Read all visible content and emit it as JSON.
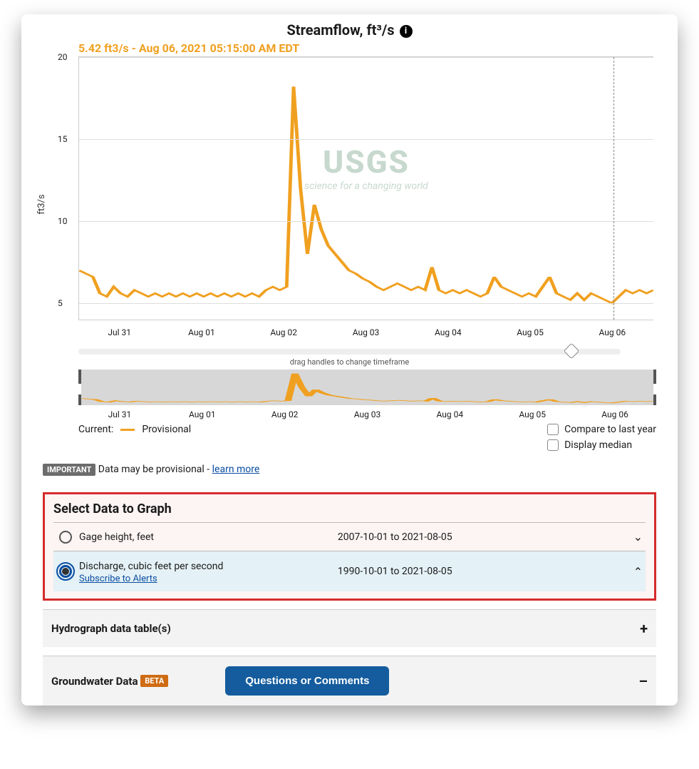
{
  "chart_data": {
    "type": "line",
    "title": "Streamflow, ft³/s",
    "ylabel": "ft3/s",
    "ylim": [
      4,
      20
    ],
    "yticks": [
      5,
      10,
      15,
      20
    ],
    "x_categories": [
      "Jul 31",
      "Aug 01",
      "Aug 02",
      "Aug 03",
      "Aug 04",
      "Aug 05",
      "Aug 06"
    ],
    "series": [
      {
        "name": "Provisional",
        "color": "#f0a020",
        "values": [
          7.0,
          6.8,
          6.6,
          5.6,
          5.4,
          6.0,
          5.6,
          5.4,
          5.8,
          5.6,
          5.4,
          5.6,
          5.4,
          5.6,
          5.4,
          5.6,
          5.4,
          5.6,
          5.4,
          5.6,
          5.4,
          5.6,
          5.4,
          5.6,
          5.4,
          5.6,
          5.4,
          5.8,
          6.0,
          5.8,
          6.0,
          18.2,
          12.0,
          8.0,
          11.0,
          9.5,
          8.5,
          8.0,
          7.5,
          7.0,
          6.8,
          6.5,
          6.3,
          6.0,
          5.8,
          6.0,
          6.2,
          6.0,
          5.8,
          6.0,
          5.8,
          7.2,
          5.8,
          5.6,
          5.8,
          5.6,
          5.8,
          5.6,
          5.4,
          5.6,
          6.6,
          6.0,
          5.8,
          5.6,
          5.4,
          5.6,
          5.4,
          6.0,
          6.6,
          5.6,
          5.4,
          5.2,
          5.6,
          5.2,
          5.6,
          5.4,
          5.2,
          5.0,
          5.4,
          5.8,
          5.6,
          5.8,
          5.6,
          5.8
        ]
      }
    ],
    "cursor": {
      "x_fraction": 0.93,
      "readout": "5.42 ft3/s - Aug 06, 2021 05:15:00 AM EDT"
    },
    "watermark": {
      "logo": "USGS",
      "tagline": "science for a changing world"
    }
  },
  "brush_hint": "drag handles to change timeframe",
  "legend": {
    "current_label": "Current:",
    "series_label": "Provisional",
    "compare_label": "Compare to last year",
    "median_label": "Display median"
  },
  "important": {
    "badge": "IMPORTANT",
    "text": "Data may be provisional - ",
    "link": "learn more"
  },
  "select_section": {
    "title": "Select Data to Graph",
    "items": [
      {
        "label": "Gage height, feet",
        "range": "2007-10-01 to 2021-08-05",
        "selected": false
      },
      {
        "label": "Discharge, cubic feet per second",
        "range": "1990-10-01 to 2021-08-05",
        "selected": true,
        "subscribe": "Subscribe to Alerts"
      }
    ]
  },
  "panels": {
    "hydro": "Hydrograph data table(s)",
    "ground": "Groundwater Data",
    "beta": "BETA",
    "question_btn": "Questions or Comments"
  }
}
